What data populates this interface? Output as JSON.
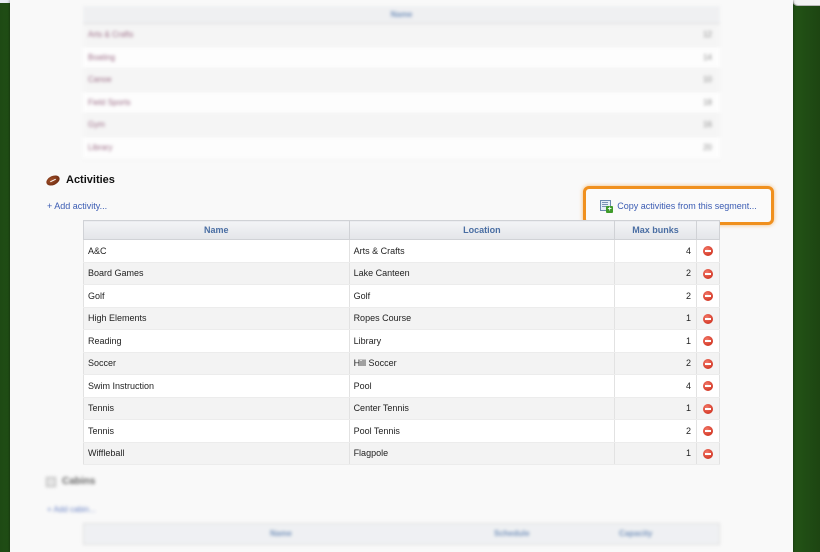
{
  "upper_table": {
    "header": "Name",
    "rows": [
      {
        "label": "Arts & Crafts",
        "value": "12"
      },
      {
        "label": "Boating",
        "value": "14"
      },
      {
        "label": "Canoe",
        "value": "10"
      },
      {
        "label": "Field Sports",
        "value": "18"
      },
      {
        "label": "Gym",
        "value": "16"
      },
      {
        "label": "Library",
        "value": "20"
      }
    ]
  },
  "activities": {
    "title": "Activities",
    "add_link": "+ Add activity...",
    "copy_button": "Copy activities from this segment...",
    "columns": [
      "Name",
      "Location",
      "Max bunks",
      ""
    ],
    "rows": [
      {
        "name": "A&C",
        "location": "Arts & Crafts",
        "max_bunks": "4"
      },
      {
        "name": "Board Games",
        "location": "Lake Canteen",
        "max_bunks": "2"
      },
      {
        "name": "Golf",
        "location": "Golf",
        "max_bunks": "2"
      },
      {
        "name": "High Elements",
        "location": "Ropes Course",
        "max_bunks": "1"
      },
      {
        "name": "Reading",
        "location": "Library",
        "max_bunks": "1"
      },
      {
        "name": "Soccer",
        "location": "Hill Soccer",
        "max_bunks": "2"
      },
      {
        "name": "Swim Instruction",
        "location": "Pool",
        "max_bunks": "4"
      },
      {
        "name": "Tennis",
        "location": "Center Tennis",
        "max_bunks": "1"
      },
      {
        "name": "Tennis",
        "location": "Pool Tennis",
        "max_bunks": "2"
      },
      {
        "name": "Wiffleball",
        "location": "Flagpole",
        "max_bunks": "1"
      }
    ]
  },
  "lower_section": {
    "title": "Cabins",
    "add_link": "+ Add cabin...",
    "columns": [
      "Name",
      "Schedule",
      "Capacity"
    ]
  },
  "colors": {
    "accent_link": "#3b5cb3",
    "highlight_border": "#f0901e",
    "header_text": "#4a6ea3",
    "background_green": "#2c6a1c"
  },
  "icons": {
    "section": "football-icon",
    "copy": "copy-add-icon",
    "delete": "delete-icon"
  }
}
